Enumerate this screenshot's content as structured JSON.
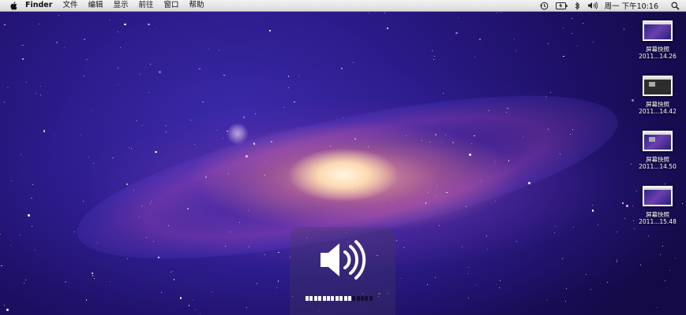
{
  "menubar": {
    "app_name": "Finder",
    "items": [
      "文件",
      "编辑",
      "显示",
      "前往",
      "窗口",
      "帮助"
    ],
    "clock": "周一 下午10:16"
  },
  "status_icons": [
    "time-machine-icon",
    "battery-icon",
    "bluetooth-icon",
    "volume-icon",
    "spotlight-icon"
  ],
  "desktop_icons": [
    {
      "name_line1": "屏幕快照",
      "name_line2": "2011...14.26"
    },
    {
      "name_line1": "屏幕快照",
      "name_line2": "2011...14.42"
    },
    {
      "name_line1": "屏幕快照",
      "name_line2": "2011...14.50"
    },
    {
      "name_line1": "屏幕快照",
      "name_line2": "2011...15.48"
    }
  ],
  "volume_hud": {
    "level": 0.69,
    "segments_total": 16
  }
}
